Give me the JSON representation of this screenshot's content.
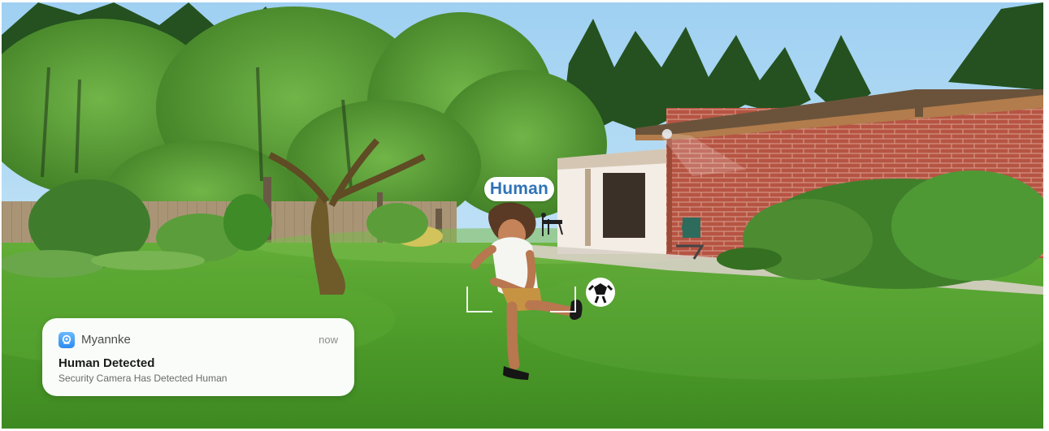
{
  "detection": {
    "label": "Human"
  },
  "notification": {
    "app_name": "Myannke",
    "time": "now",
    "title": "Human Detected",
    "body": "Security Camera Has Detected Human",
    "icon": "camera-app-icon"
  },
  "colors": {
    "label_text": "#2f73b8",
    "app_icon": "#2c8af0",
    "grass": "#4f9a2d",
    "brick": "#b65444",
    "sky": "#a9d6f3"
  }
}
